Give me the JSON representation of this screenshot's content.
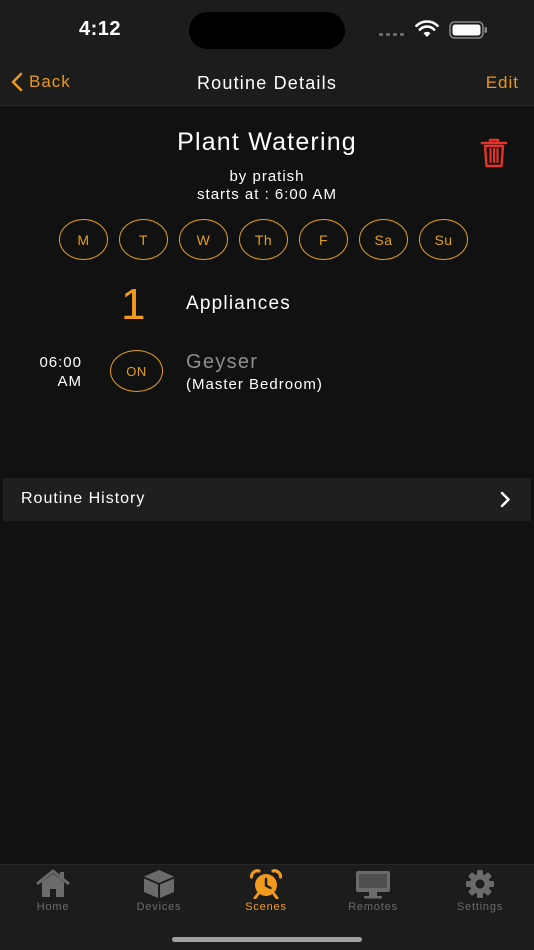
{
  "status_bar": {
    "time": "4:12"
  },
  "nav": {
    "back_label": "Back",
    "title": "Routine Details",
    "edit_label": "Edit"
  },
  "routine": {
    "name": "Plant Watering",
    "author": "by pratish",
    "start": "starts at : 6:00 AM",
    "days": [
      "M",
      "T",
      "W",
      "Th",
      "F",
      "Sa",
      "Su"
    ]
  },
  "appliances": {
    "count": "1",
    "label": "Appliances",
    "items": [
      {
        "time_hm": "06:00",
        "time_ampm": "AM",
        "state": "ON",
        "name": "Geyser",
        "room": "(Master Bedroom)"
      }
    ]
  },
  "history": {
    "label": "Routine History"
  },
  "tabs": [
    {
      "label": "Home",
      "icon": "home-icon"
    },
    {
      "label": "Devices",
      "icon": "cube-icon"
    },
    {
      "label": "Scenes",
      "icon": "alarm-clock-icon"
    },
    {
      "label": "Remotes",
      "icon": "monitor-icon"
    },
    {
      "label": "Settings",
      "icon": "gear-icon"
    }
  ],
  "colors": {
    "accent": "#f19a1c",
    "danger": "#e5332a",
    "background": "#111111"
  }
}
